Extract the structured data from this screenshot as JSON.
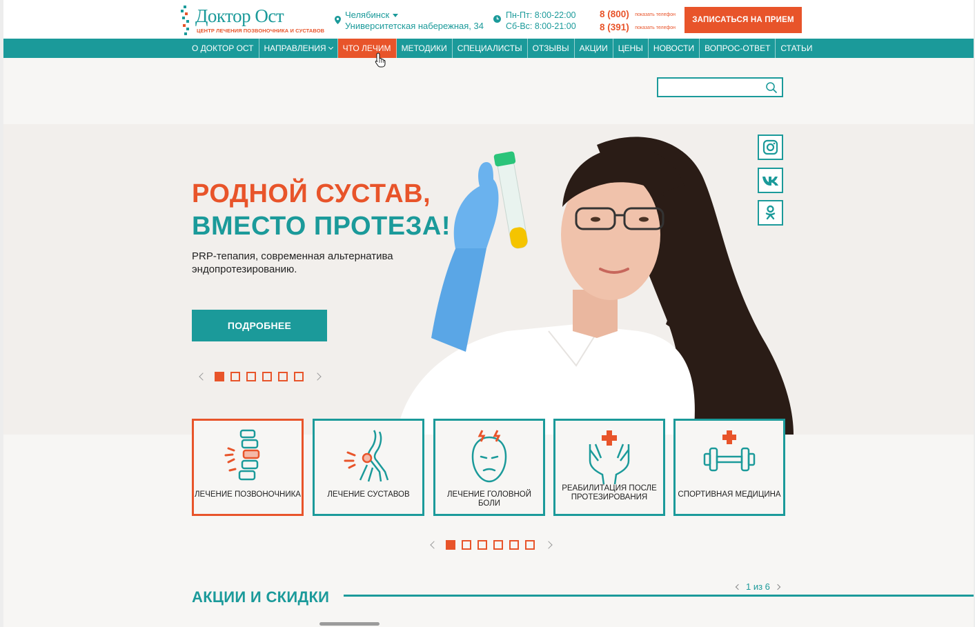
{
  "header": {
    "logo_title": "Доктор Ост",
    "logo_subtitle": "ЦЕНТР ЛЕЧЕНИЯ ПОЗВОНОЧНИКА И СУСТАВОВ",
    "city": "Челябинск",
    "address": "Университетская набережная, 34",
    "hours_weekday": "Пн-Пт: 8:00-22:00",
    "hours_weekend": "Сб-Вс:  8:00-21:00",
    "phones": [
      {
        "number": "8 (800)",
        "show_label": "показать телефон"
      },
      {
        "number": "8 (391)",
        "show_label": "показать телефон"
      }
    ],
    "cta_label": "ЗАПИСАТЬСЯ НА ПРИЕМ"
  },
  "nav": {
    "items": [
      {
        "label": "О ДОКТОР ОСТ"
      },
      {
        "label": "НАПРАВЛЕНИЯ"
      },
      {
        "label": "ЧТО ЛЕЧИМ"
      },
      {
        "label": "МЕТОДИКИ"
      },
      {
        "label": "СПЕЦИАЛИСТЫ"
      },
      {
        "label": "ОТЗЫВЫ"
      },
      {
        "label": "АКЦИИ"
      },
      {
        "label": "ЦЕНЫ"
      },
      {
        "label": "НОВОСТИ"
      },
      {
        "label": "ВОПРОС-ОТВЕТ"
      },
      {
        "label": "СТАТЬИ"
      }
    ],
    "active_index": 2
  },
  "search": {
    "value": "",
    "placeholder": ""
  },
  "hero": {
    "title_line1": "РОДНОЙ СУСТАВ,",
    "title_line2": "ВМЕСТО ПРОТЕЗА!",
    "subtitle": "PRP-тепапия, современная альтернатива эндопротезированию.",
    "button_label": "ПОДРОБНЕЕ",
    "slide_count": 6,
    "active_slide": 1
  },
  "social": [
    {
      "name": "instagram-icon"
    },
    {
      "name": "vk-icon"
    },
    {
      "name": "odnoklassniki-icon"
    }
  ],
  "cards": [
    {
      "label": "ЛЕЧЕНИЕ ПОЗВОНОЧНИКА",
      "icon": "spine-icon"
    },
    {
      "label": "ЛЕЧЕНИЕ СУСТАВОВ",
      "icon": "knee-joint-icon"
    },
    {
      "label": "ЛЕЧЕНИЕ ГОЛОВНОЙ БОЛИ",
      "icon": "headache-icon"
    },
    {
      "label": "РЕАБИЛИТАЦИЯ ПОСЛЕ ПРОТЕЗИРОВАНИЯ",
      "icon": "rehab-hands-icon"
    },
    {
      "label": "СПОРТИВНАЯ МЕДИЦИНА",
      "icon": "dumbbell-icon"
    }
  ],
  "cards_pager": {
    "count": 6,
    "active": 1
  },
  "promo": {
    "title": "АКЦИИ И СКИДКИ",
    "pager": "1 из 6"
  },
  "colors": {
    "teal": "#1b9a9a",
    "orange": "#e8542a"
  }
}
